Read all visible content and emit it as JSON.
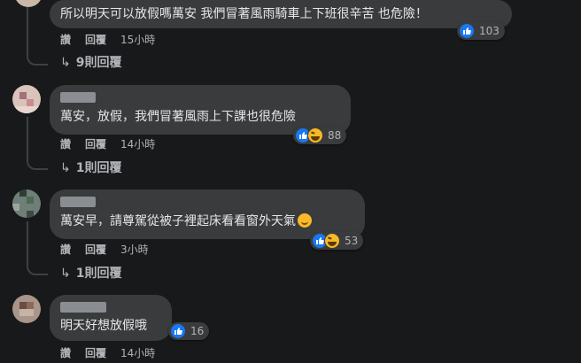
{
  "comments": [
    {
      "text": "所以明天可以放假嗎萬安 我們冒著風雨騎車上下班很辛苦 也危險！",
      "actions": {
        "like": "讚",
        "reply": "回覆"
      },
      "time": "15小時",
      "reaction_count": "103",
      "reactions": [
        "like-icon"
      ],
      "replies_label": "9則回覆"
    },
    {
      "text": "萬安，放假，我們冒著風雨上下課也很危險",
      "actions": {
        "like": "讚",
        "reply": "回覆"
      },
      "time": "14小時",
      "reaction_count": "88",
      "reactions": [
        "like-icon",
        "haha-icon"
      ],
      "replies_label": "1則回覆"
    },
    {
      "text": "萬安早，請尊駕從被子裡起床看看窗外天氣",
      "actions": {
        "like": "讚",
        "reply": "回覆"
      },
      "time": "3小時",
      "reaction_count": "53",
      "reactions": [
        "like-icon",
        "haha-icon"
      ],
      "replies_label": "1則回覆"
    },
    {
      "text": "明天好想放假哦",
      "actions": {
        "like": "讚",
        "reply": "回覆"
      },
      "time": "14小時",
      "reaction_count": "16",
      "reactions": [
        "like-icon"
      ]
    }
  ],
  "colors": {
    "background": "#18191a",
    "bubble": "#3a3b3c",
    "text": "#e4e6eb",
    "muted": "#b0b3b8",
    "like_blue": "#1877f2",
    "haha_yellow": "#f7b928"
  }
}
